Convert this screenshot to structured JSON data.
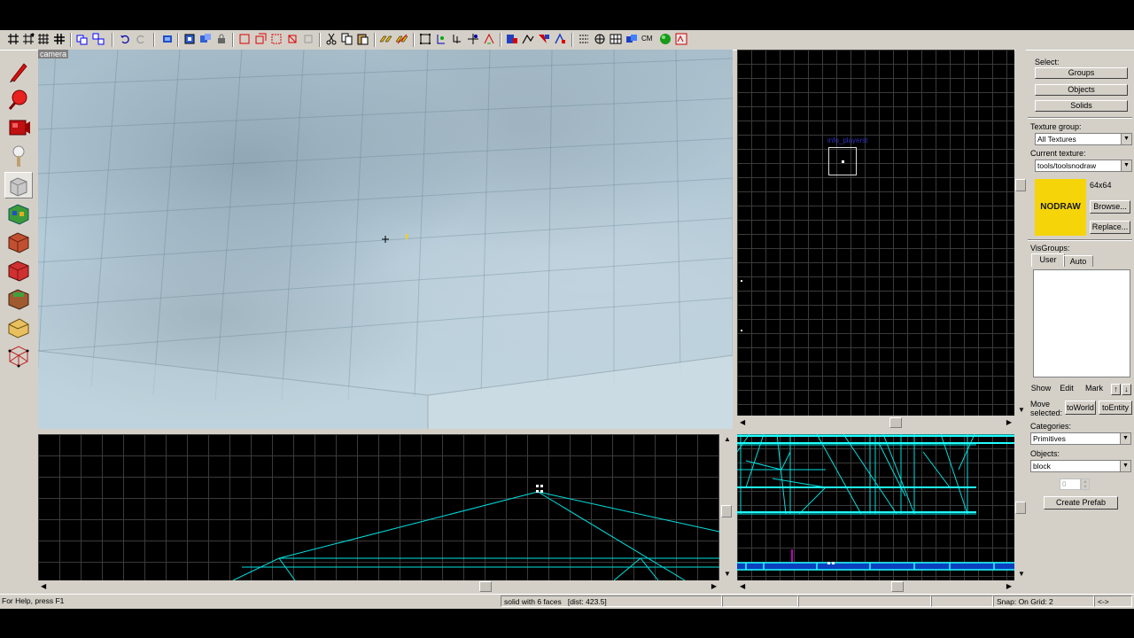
{
  "camera_view": {
    "label": "camera"
  },
  "top_view": {
    "entity_label": "info_playerst"
  },
  "select_panel": {
    "select_label": "Select:",
    "groups": "Groups",
    "objects": "Objects",
    "solids": "Solids",
    "texture_group_label": "Texture group:",
    "texture_group_value": "All Textures",
    "current_texture_label": "Current texture:",
    "current_texture_value": "tools/toolsnodraw",
    "texture_preview_text": "NODRAW",
    "texture_size": "64x64",
    "browse": "Browse...",
    "replace": "Replace...",
    "visgroups_label": "VisGroups:",
    "tab_user": "User",
    "tab_auto": "Auto",
    "show": "Show",
    "edit": "Edit",
    "mark": "Mark",
    "move_selected_label_1": "Move",
    "move_selected_label_2": "selected:",
    "to_world": "toWorld",
    "to_entity": "toEntity",
    "categories_label": "Categories:",
    "categories_value": "Primitives",
    "objects_label": "Objects:",
    "objects_value": "block",
    "faces_value": "0",
    "create_prefab": "Create Prefab"
  },
  "status_bar": {
    "help": "For Help, press F1",
    "selection": "solid with 6 faces",
    "dist": "[dist: 423.5]",
    "snap": "Snap: On Grid: 2",
    "arrows": "<->"
  },
  "colors": {
    "wire": "#00e5e5",
    "wire_bright": "#20ffff",
    "nodraw_bg": "#f5d50a",
    "entity_blue": "#3030c0"
  }
}
